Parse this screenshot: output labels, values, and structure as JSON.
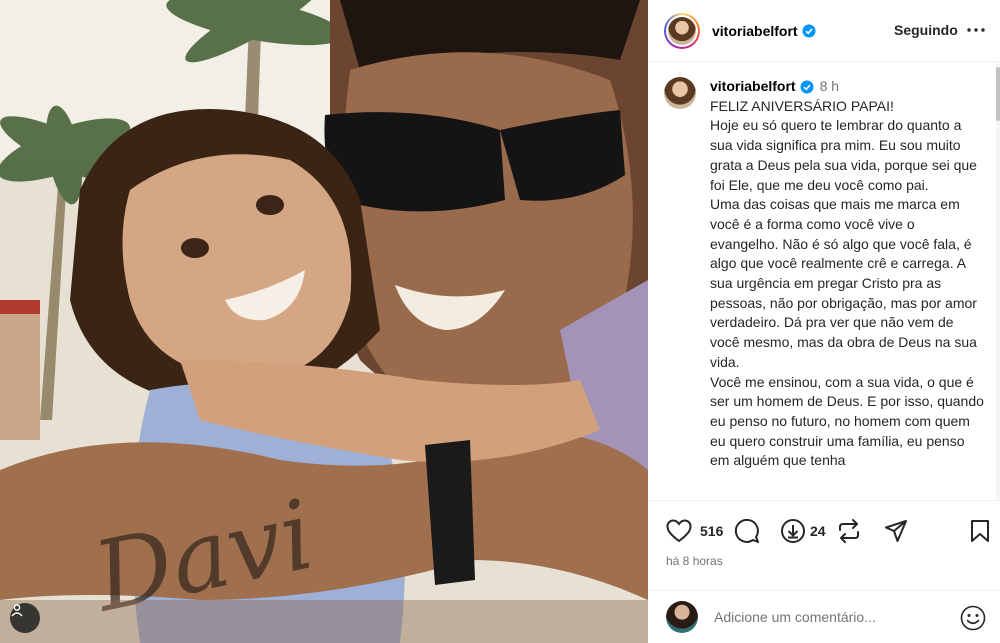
{
  "post": {
    "photo": {
      "tattoo_text": "Davi",
      "tagged_icon": "user-tag-icon"
    },
    "header": {
      "username": "vitoriabelfort",
      "verified_icon": "verified-badge-icon",
      "follow_label": "Seguindo",
      "more_icon": "more-options-icon"
    },
    "caption": {
      "username": "vitoriabelfort",
      "time": "8 h",
      "text": "FELIZ ANIVERSÁRIO PAPAI!\nHoje eu só quero te lembrar do quanto a sua vida significa pra mim. Eu sou muito grata a Deus pela sua vida, porque sei que foi Ele, que me deu você como pai.\nUma das coisas que mais me marca em você é a forma como você vive o evangelho. Não é só algo que você fala, é algo que você realmente crê e carrega. A sua urgência em pregar Cristo pra as pessoas, não por obrigação, mas por amor verdadeiro. Dá pra ver que não vem de você mesmo, mas da obra de Deus na sua vida.\nVocê me ensinou, com a sua vida, o que é ser um homem de Deus. E por isso, quando eu penso no futuro, no homem com quem eu quero construir uma família, eu penso em alguém que tenha"
    },
    "actions": {
      "like_icon": "heart-icon",
      "like_count": "516",
      "comment_icon": "comment-icon",
      "repost_icon": "download-circle-icon",
      "repost_count": "24",
      "share_icon": "repost-arrows-icon",
      "send_icon": "paper-plane-icon",
      "save_icon": "bookmark-icon"
    },
    "timestamp": "há 8 horas",
    "comment": {
      "placeholder": "Adicione um comentário...",
      "emoji_icon": "smiley-icon"
    }
  }
}
